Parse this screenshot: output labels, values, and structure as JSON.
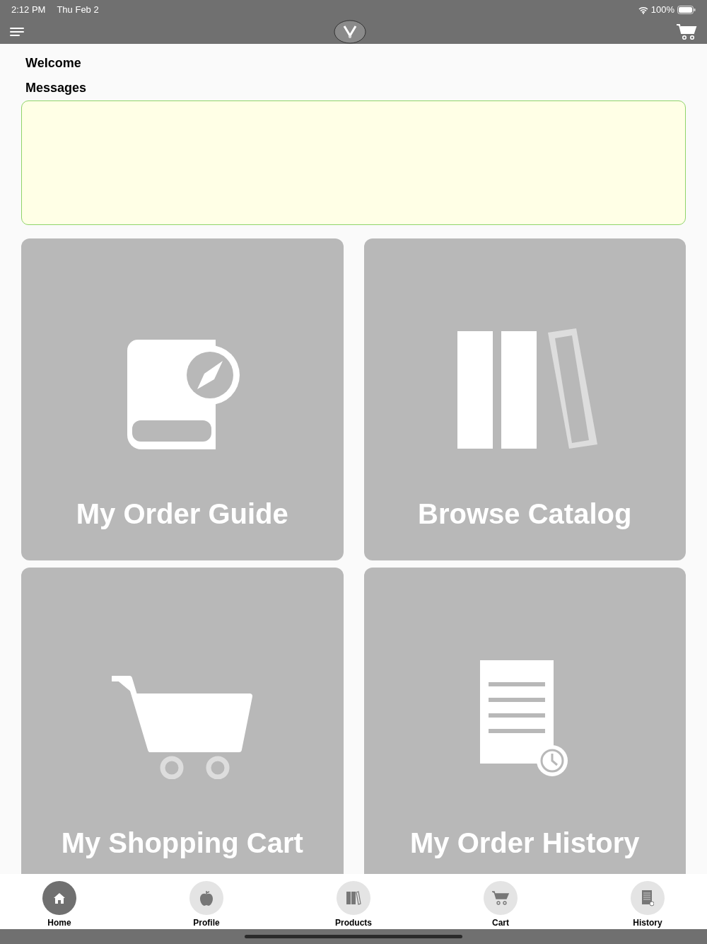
{
  "status_bar": {
    "time": "2:12 PM",
    "date": "Thu Feb 2",
    "battery": "100%"
  },
  "header": {
    "welcome": "Welcome",
    "messages_label": "Messages"
  },
  "tiles": [
    {
      "kind": "guide",
      "label": "My Order Guide"
    },
    {
      "kind": "catalog",
      "label": "Browse Catalog"
    },
    {
      "kind": "cart",
      "label": "My Shopping Cart"
    },
    {
      "kind": "history",
      "label": "My Order History"
    }
  ],
  "tabs": [
    {
      "kind": "home",
      "label": "Home",
      "selected": true
    },
    {
      "kind": "profile",
      "label": "Profile",
      "selected": false
    },
    {
      "kind": "products",
      "label": "Products",
      "selected": false
    },
    {
      "kind": "cart",
      "label": "Cart",
      "selected": false
    },
    {
      "kind": "history",
      "label": "History",
      "selected": false
    }
  ]
}
